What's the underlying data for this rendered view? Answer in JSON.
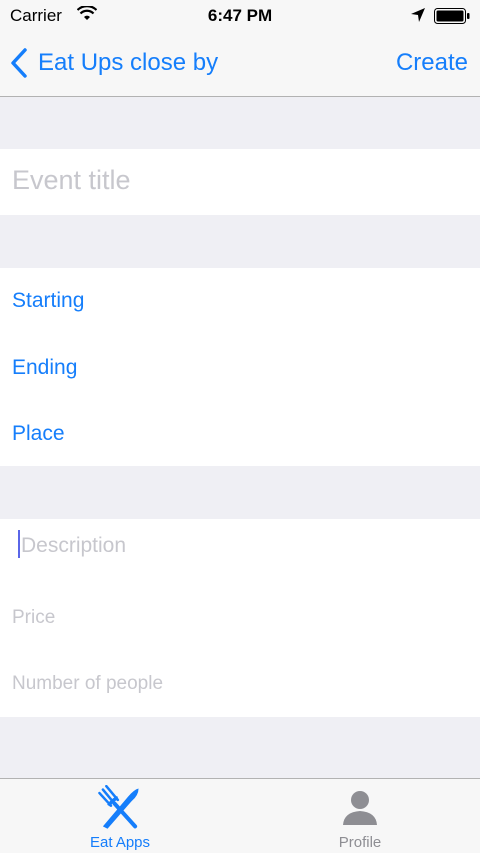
{
  "status": {
    "carrier": "Carrier",
    "time": "6:47 PM"
  },
  "nav": {
    "back_label": "Eat Ups close by",
    "action_label": "Create"
  },
  "form": {
    "title_placeholder": "Event title",
    "starting": "Starting",
    "ending": "Ending",
    "place": "Place",
    "description_placeholder": "Description",
    "price_placeholder": "Price",
    "people_placeholder": "Number of people"
  },
  "tabs": [
    {
      "label": "Eat Apps",
      "icon": "fork-knife-icon",
      "active": true
    },
    {
      "label": "Profile",
      "icon": "person-icon",
      "active": false
    }
  ],
  "colors": {
    "accent": "#157efb",
    "placeholder": "#c7c7cd",
    "background": "#efeff4"
  }
}
